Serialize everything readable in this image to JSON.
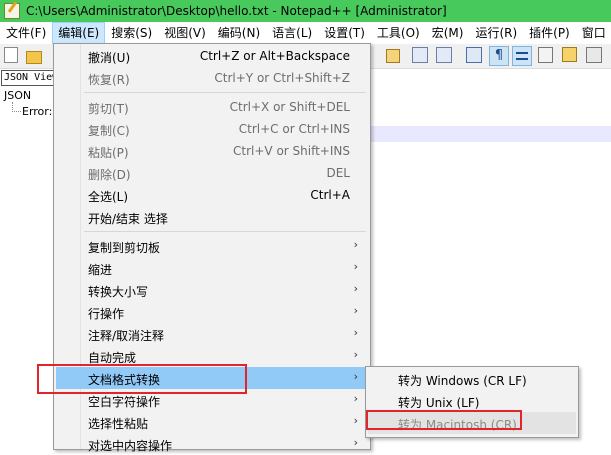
{
  "window": {
    "title": "C:\\Users\\Administrator\\Desktop\\hello.txt - Notepad++ [Administrator]"
  },
  "menubar": {
    "items": [
      "文件(F)",
      "编辑(E)",
      "搜索(S)",
      "视图(V)",
      "编码(N)",
      "语言(L)",
      "设置(T)",
      "工具(O)",
      "宏(M)",
      "运行(R)",
      "插件(P)",
      "窗口"
    ],
    "active": "编辑(E)"
  },
  "panel": {
    "tab_label": "JSON Viewer",
    "tree_root": "JSON",
    "tree_child": "Error:"
  },
  "toolbar": {
    "pilcrow": "¶"
  },
  "edit_menu": {
    "items": [
      {
        "label": "撤消(U)",
        "shortcut": "Ctrl+Z or Alt+Backspace",
        "enabled": true
      },
      {
        "label": "恢复(R)",
        "shortcut": "Ctrl+Y or Ctrl+Shift+Z",
        "enabled": false
      },
      {
        "label": "剪切(T)",
        "shortcut": "Ctrl+X or Shift+DEL",
        "enabled": false
      },
      {
        "label": "复制(C)",
        "shortcut": "Ctrl+C or Ctrl+INS",
        "enabled": false
      },
      {
        "label": "粘贴(P)",
        "shortcut": "Ctrl+V or Shift+INS",
        "enabled": false
      },
      {
        "label": "删除(D)",
        "shortcut": "DEL",
        "enabled": false
      },
      {
        "label": "全选(L)",
        "shortcut": "Ctrl+A",
        "enabled": true
      },
      {
        "label": "开始/结束 选择",
        "shortcut": "",
        "enabled": true
      },
      {
        "label": "复制到剪切板",
        "submenu": true
      },
      {
        "label": "缩进",
        "submenu": true
      },
      {
        "label": "转换大小写",
        "submenu": true
      },
      {
        "label": "行操作",
        "submenu": true
      },
      {
        "label": "注释/取消注释",
        "submenu": true
      },
      {
        "label": "自动完成",
        "submenu": true
      },
      {
        "label": "文档格式转换",
        "submenu": true,
        "highlighted": true
      },
      {
        "label": "空白字符操作",
        "submenu": true
      },
      {
        "label": "选择性粘贴",
        "submenu": true
      },
      {
        "label": "对选中内容操作",
        "submenu": true
      }
    ],
    "arrow_glyph": "›"
  },
  "eol_submenu": {
    "items": [
      {
        "label": "转为 Windows (CR LF)",
        "enabled": true
      },
      {
        "label": "转为 Unix (LF)",
        "enabled": true
      },
      {
        "label": "转为 Macintosh (CR)",
        "enabled": false
      }
    ]
  },
  "colors": {
    "titlebar": "#47c95c",
    "highlight": "#91c9f7",
    "annotation": "#e0262b"
  }
}
